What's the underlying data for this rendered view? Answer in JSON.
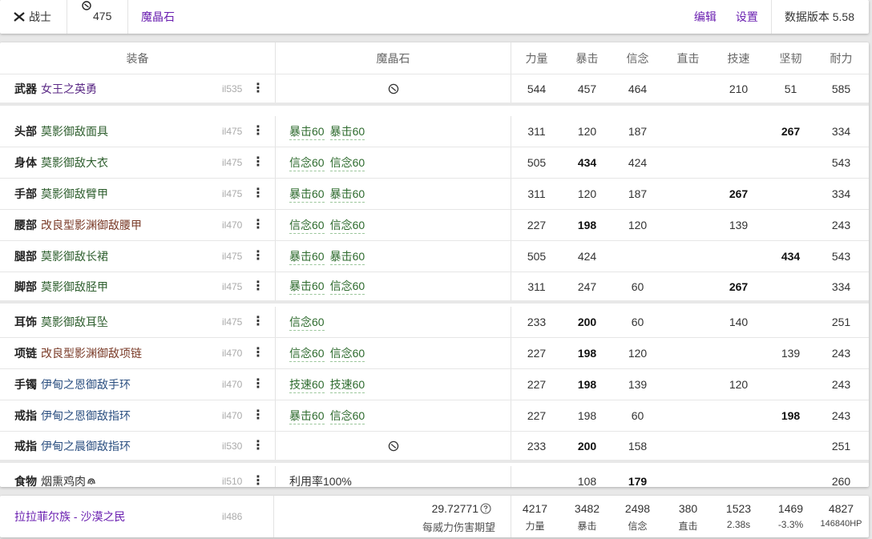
{
  "topbar": {
    "job": "战士",
    "job_icon": "warrior-job-icon",
    "level": "475",
    "materia_link": "魔晶石",
    "edit": "编辑",
    "settings": "设置",
    "version": "数据版本 5.58"
  },
  "colors": {
    "link_purple": "#6a1fb0",
    "materia_green": "#2e6b2e",
    "name_purple": "#5b2a86",
    "name_green": "#2f5f2f",
    "name_blue": "#2b4f80",
    "name_brown": "#7a3b28"
  },
  "table": {
    "headers": {
      "gear": "装备",
      "materia": "魔晶石",
      "stats": [
        "力量",
        "暴击",
        "信念",
        "直击",
        "技速",
        "坚韧",
        "耐力"
      ]
    },
    "rows": [
      {
        "slot": "武器",
        "name": "女王之英勇",
        "name_color": "purple",
        "ilv": "il535",
        "materia": [],
        "materia_icon": "materia-slot-icon",
        "stats": [
          "544",
          "457",
          "464",
          "",
          "210",
          "51",
          "585"
        ],
        "bold": []
      },
      {
        "slot": "头部",
        "name": "莫影御敌面具",
        "name_color": "green",
        "ilv": "il475",
        "materia": [
          "暴击60",
          "暴击60"
        ],
        "stats": [
          "311",
          "120",
          "187",
          "",
          "",
          "267",
          "334"
        ],
        "bold": [
          5
        ]
      },
      {
        "slot": "身体",
        "name": "莫影御敌大衣",
        "name_color": "green",
        "ilv": "il475",
        "materia": [
          "信念60",
          "信念60"
        ],
        "stats": [
          "505",
          "434",
          "424",
          "",
          "",
          "",
          "543"
        ],
        "bold": [
          1
        ]
      },
      {
        "slot": "手部",
        "name": "莫影御敌臂甲",
        "name_color": "green",
        "ilv": "il475",
        "materia": [
          "暴击60",
          "暴击60"
        ],
        "stats": [
          "311",
          "120",
          "187",
          "",
          "267",
          "",
          "334"
        ],
        "bold": [
          4
        ]
      },
      {
        "slot": "腰部",
        "name": "改良型影渊御敌腰甲",
        "name_color": "brown",
        "ilv": "il470",
        "materia": [
          "信念60",
          "信念60"
        ],
        "stats": [
          "227",
          "198",
          "120",
          "",
          "139",
          "",
          "243"
        ],
        "bold": [
          1
        ]
      },
      {
        "slot": "腿部",
        "name": "莫影御敌长裙",
        "name_color": "green",
        "ilv": "il475",
        "materia": [
          "暴击60",
          "暴击60"
        ],
        "stats": [
          "505",
          "424",
          "",
          "",
          "",
          "434",
          "543"
        ],
        "bold": [
          5
        ]
      },
      {
        "slot": "脚部",
        "name": "莫影御敌胫甲",
        "name_color": "green",
        "ilv": "il475",
        "materia": [
          "暴击60",
          "信念60"
        ],
        "stats": [
          "311",
          "247",
          "60",
          "",
          "267",
          "",
          "334"
        ],
        "bold": [
          4
        ]
      },
      {
        "slot": "耳饰",
        "name": "莫影御敌耳坠",
        "name_color": "green",
        "ilv": "il475",
        "materia": [
          "信念60"
        ],
        "stats": [
          "233",
          "200",
          "60",
          "",
          "140",
          "",
          "251"
        ],
        "bold": [
          1
        ]
      },
      {
        "slot": "项链",
        "name": "改良型影渊御敌项链",
        "name_color": "brown",
        "ilv": "il470",
        "materia": [
          "信念60",
          "信念60"
        ],
        "stats": [
          "227",
          "198",
          "120",
          "",
          "",
          "139",
          "243"
        ],
        "bold": [
          1
        ]
      },
      {
        "slot": "手镯",
        "name": "伊甸之恩御敌手环",
        "name_color": "blue",
        "ilv": "il470",
        "materia": [
          "技速60",
          "技速60"
        ],
        "stats": [
          "227",
          "198",
          "139",
          "",
          "120",
          "",
          "243"
        ],
        "bold": [
          1
        ]
      },
      {
        "slot": "戒指",
        "name": "伊甸之恩御敌指环",
        "name_color": "blue",
        "ilv": "il470",
        "materia": [
          "暴击60",
          "信念60"
        ],
        "stats": [
          "227",
          "198",
          "60",
          "",
          "",
          "198",
          "243"
        ],
        "bold": [
          5
        ]
      },
      {
        "slot": "戒指",
        "name": "伊甸之晨御敌指环",
        "name_color": "blue",
        "ilv": "il530",
        "materia": [],
        "materia_icon": "materia-slot-icon",
        "stats": [
          "233",
          "200",
          "158",
          "",
          "",
          "",
          "251"
        ],
        "bold": [
          1
        ]
      },
      {
        "slot": "食物",
        "name": "烟熏鸡肉",
        "name_color": "dark",
        "name_icon": "food-hq-icon",
        "ilv": "il510",
        "materia_text": "利用率100%",
        "stats": [
          "",
          "108",
          "179",
          "",
          "",
          "",
          "260"
        ],
        "bold": [
          2
        ]
      }
    ]
  },
  "footer": {
    "race": "拉拉菲尔族 - 沙漠之民",
    "ilv": "il486",
    "damage_value": "29.72771",
    "damage_label": "每威力伤害期望",
    "stats": [
      {
        "value": "4217",
        "label": "力量"
      },
      {
        "value": "3482",
        "label": "暴击"
      },
      {
        "value": "2498",
        "label": "信念"
      },
      {
        "value": "380",
        "label": "直击"
      },
      {
        "value": "1523",
        "label": "2.38s"
      },
      {
        "value": "1469",
        "label": "-3.3%"
      },
      {
        "value": "4827",
        "label": "146840HP"
      }
    ]
  }
}
